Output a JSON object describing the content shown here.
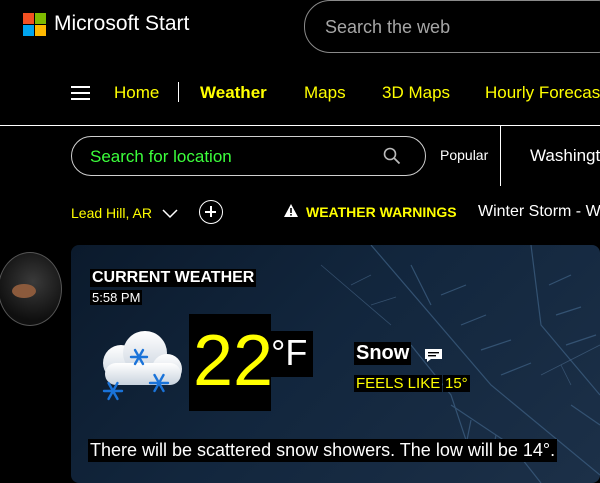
{
  "header": {
    "brand": "Microsoft Start",
    "search_placeholder": "Search the web"
  },
  "nav": {
    "items": [
      {
        "label": "Home"
      },
      {
        "label": "Weather"
      },
      {
        "label": "Maps"
      },
      {
        "label": "3D Maps"
      },
      {
        "label": "Hourly Forecast"
      }
    ]
  },
  "location_bar": {
    "search_placeholder": "Search for location",
    "popular_label": "Popular",
    "popular_city": "Washington"
  },
  "location": {
    "name": "Lead Hill, AR",
    "warnings_label": "WEATHER WARNINGS",
    "warning_text": "Winter Storm - W"
  },
  "current": {
    "title": "CURRENT WEATHER",
    "time": "5:58 PM",
    "temperature": "22",
    "unit": "°F",
    "condition": "Snow",
    "feels_like_label": "FEELS LIKE",
    "feels_like_value": "15°",
    "description": "There will be scattered snow showers. The low will be 14°."
  },
  "colors": {
    "accent": "#ffff00",
    "location_search_text": "#3cff3c",
    "card_bg": "#12263d"
  }
}
